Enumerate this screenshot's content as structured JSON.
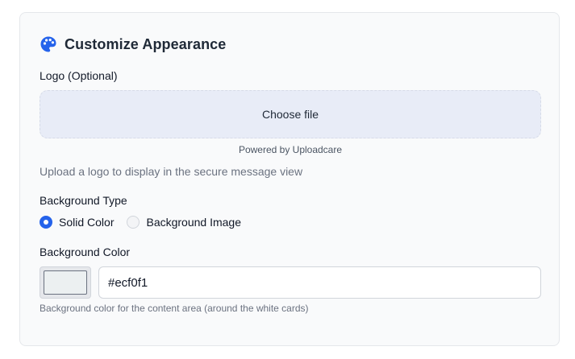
{
  "section": {
    "title": "Customize Appearance",
    "icon": "palette-icon"
  },
  "logo": {
    "label": "Logo (Optional)",
    "choose_file_label": "Choose file",
    "powered_by": "Powered by Uploadcare",
    "hint": "Upload a logo to display in the secure message view"
  },
  "background_type": {
    "label": "Background Type",
    "options": [
      {
        "label": "Solid Color",
        "selected": true
      },
      {
        "label": "Background Image",
        "selected": false
      }
    ]
  },
  "background_color": {
    "label": "Background Color",
    "value": "#ecf0f1",
    "help": "Background color for the content area (around the white cards)"
  },
  "colors": {
    "accent": "#2563eb",
    "upload_bg": "#e8ecf7"
  }
}
